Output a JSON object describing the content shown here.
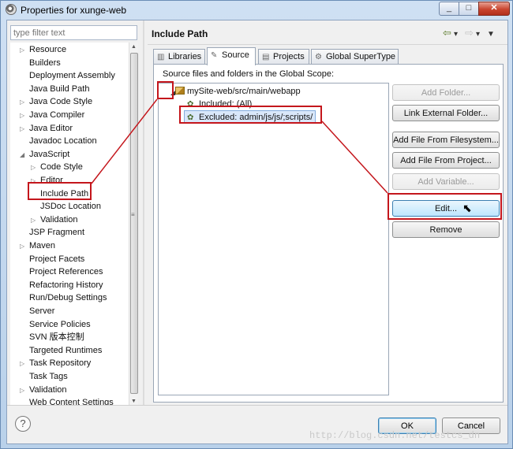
{
  "window": {
    "title": "Properties for xunge-web"
  },
  "filter": {
    "placeholder": "type filter text"
  },
  "left_tree": [
    {
      "label": "Resource",
      "arrow": "▷"
    },
    {
      "label": "Builders",
      "arrow": ""
    },
    {
      "label": "Deployment Assembly",
      "arrow": ""
    },
    {
      "label": "Java Build Path",
      "arrow": ""
    },
    {
      "label": "Java Code Style",
      "arrow": "▷"
    },
    {
      "label": "Java Compiler",
      "arrow": "▷"
    },
    {
      "label": "Java Editor",
      "arrow": "▷"
    },
    {
      "label": "Javadoc Location",
      "arrow": ""
    },
    {
      "label": "JavaScript",
      "arrow": "◢"
    },
    {
      "label": "Code Style",
      "arrow": "▷"
    },
    {
      "label": "Editor",
      "arrow": "▷"
    },
    {
      "label": "Include Path",
      "arrow": ""
    },
    {
      "label": "JSDoc Location",
      "arrow": ""
    },
    {
      "label": "Validation",
      "arrow": "▷"
    },
    {
      "label": "JSP Fragment",
      "arrow": ""
    },
    {
      "label": "Maven",
      "arrow": "▷"
    },
    {
      "label": "Project Facets",
      "arrow": ""
    },
    {
      "label": "Project References",
      "arrow": ""
    },
    {
      "label": "Refactoring History",
      "arrow": ""
    },
    {
      "label": "Run/Debug Settings",
      "arrow": ""
    },
    {
      "label": "Server",
      "arrow": ""
    },
    {
      "label": "Service Policies",
      "arrow": ""
    },
    {
      "label": "SVN 版本控制",
      "arrow": ""
    },
    {
      "label": "Targeted Runtimes",
      "arrow": ""
    },
    {
      "label": "Task Repository",
      "arrow": "▷"
    },
    {
      "label": "Task Tags",
      "arrow": ""
    },
    {
      "label": "Validation",
      "arrow": "▷"
    },
    {
      "label": "Web Content Settings",
      "arrow": ""
    }
  ],
  "page": {
    "title": "Include Path"
  },
  "tabs": [
    {
      "label": "Libraries"
    },
    {
      "label": "Source"
    },
    {
      "label": "Projects"
    },
    {
      "label": "Global SuperType"
    }
  ],
  "source": {
    "scope_label": "Source files and folders in the Global Scope:",
    "root": "mySite-web/src/main/webapp",
    "included": "Included: (All)",
    "excluded": "Excluded: admin/js/js/;scripts/"
  },
  "buttons": {
    "add_folder": "Add Folder...",
    "link_external": "Link External Folder...",
    "add_file_fs": "Add File From Filesystem...",
    "add_file_project": "Add File From Project...",
    "add_variable": "Add Variable...",
    "edit": "Edit...",
    "remove": "Remove"
  },
  "footer": {
    "ok": "OK",
    "cancel": "Cancel",
    "help": "?"
  },
  "watermark": "http://blog.csdn.net/testcs_dn",
  "colors": {
    "annotation": "#c4161c",
    "accent": "#3c7fb1"
  }
}
